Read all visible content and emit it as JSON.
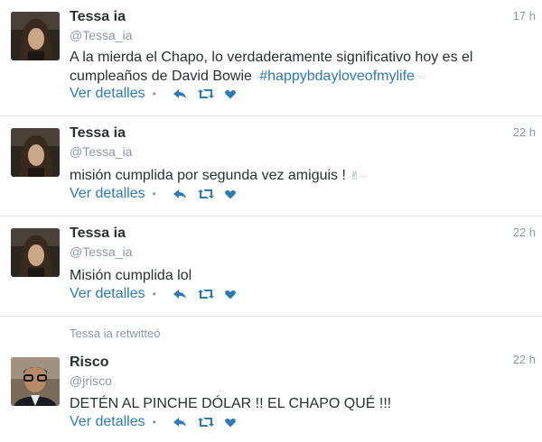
{
  "tweets": [
    {
      "name": "Tessa ia",
      "handle": "@Tessa_ia",
      "time": "17 h",
      "line1": "A la mierda el Chapo, lo verdaderamente significativo hoy es el",
      "line2": "cumpleaños de David Bowie",
      "hashtag": "#happybdayloveofmylife",
      "details": "Ver detalles"
    },
    {
      "name": "Tessa ia",
      "handle": "@Tessa_ia",
      "time": "22 h",
      "text": "misión cumplida por segunda vez amiguis !",
      "emoji": "✌",
      "details": "Ver detalles"
    },
    {
      "name": "Tessa ia",
      "handle": "@Tessa_ia",
      "time": "22 h",
      "text": "Misión cumplida lol",
      "details": "Ver detalles"
    },
    {
      "context": "Tessa ia retwitteó",
      "name": "Risco",
      "handle": "@jrisco",
      "time": "22 h",
      "text": "DETÉN AL PINCHE DÓLAR !! EL CHAPO QUÉ !!!",
      "details": "Ver detalles"
    }
  ],
  "icons": {
    "reply": "reply-icon",
    "retweet": "retweet-icon",
    "favorite": "heart-icon"
  },
  "colors": {
    "link": "#2b7bb9",
    "muted": "#8899a6",
    "text": "#292f33",
    "divider": "#e1e8ed"
  }
}
